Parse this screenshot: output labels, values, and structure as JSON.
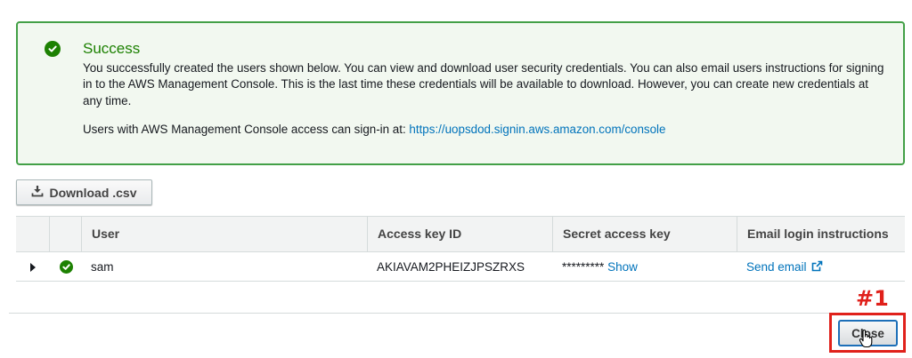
{
  "alert": {
    "title": "Success",
    "message": "You successfully created the users shown below. You can view and download user security credentials. You can also email users instructions for signing in to the AWS Management Console. This is the last time these credentials will be available to download. However, you can create new credentials at any time.",
    "signin_prefix": "Users with AWS Management Console access can sign-in at: ",
    "signin_url": "https://uopsdod.signin.aws.amazon.com/console",
    "icon": "check-circle-icon"
  },
  "toolbar": {
    "download_label": "Download .csv",
    "download_icon": "download-icon"
  },
  "table": {
    "headers": {
      "user": "User",
      "access_key_id": "Access key ID",
      "secret_access_key": "Secret access key",
      "email_login": "Email login instructions"
    },
    "rows": [
      {
        "user": "sam",
        "access_key_id": "AKIAVAM2PHEIZJPSZRXS",
        "secret_masked": "*********",
        "secret_show": "Show",
        "email_link": "Send email"
      }
    ]
  },
  "footer": {
    "close_label": "Close"
  },
  "annotation": {
    "label": "#1",
    "color": "#e0211b"
  },
  "colors": {
    "success": "#1d8102",
    "link": "#0073bb",
    "alert_border": "#43a047",
    "alert_bg": "#f2f8f0"
  }
}
